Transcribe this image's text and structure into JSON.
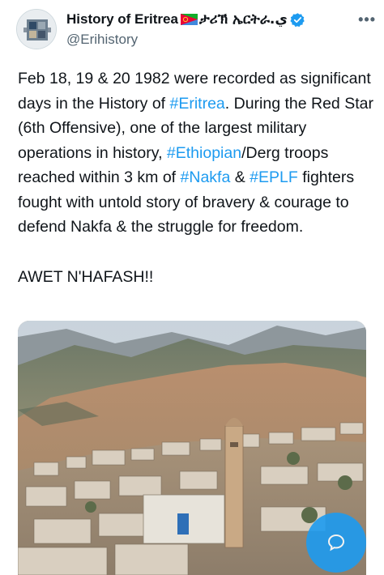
{
  "account": {
    "display_name": "History of Eritrea",
    "ethiopic_name": "ታሪኽ ኤርትራ.",
    "arabic_mark": "ي",
    "handle": "@Erihistory",
    "verified": true,
    "flag_icon": "eritrea-flag-icon",
    "more_icon": "more-dots-icon"
  },
  "tweet": {
    "segments": [
      {
        "text": "Feb 18, 19 & 20 1982 were recorded as significant days in the History of "
      },
      {
        "text": "#Eritrea",
        "hashtag": true
      },
      {
        "text": ". During the Red Star (6th Offensive), one of the largest military operations in history, "
      },
      {
        "text": "#Ethiopian",
        "hashtag": true
      },
      {
        "text": "/Derg troops reached within 3 km of "
      },
      {
        "text": "#Nakfa",
        "hashtag": true
      },
      {
        "text": " & "
      },
      {
        "text": "#EPLF",
        "hashtag": true
      },
      {
        "text": " fighters fought with untold story of bravery & courage to defend Nakfa & the struggle for freedom."
      }
    ],
    "closing_line": "AWET N'HAFASH!!"
  },
  "media": {
    "kind": "photo",
    "description_icon": "landscape-photo"
  },
  "fab": {
    "icon": "reply-bubble-icon"
  },
  "colors": {
    "hashtag": "#1d9bf0",
    "text": "#0f1419",
    "secondary": "#536471",
    "verified": "#1d9bf0"
  }
}
